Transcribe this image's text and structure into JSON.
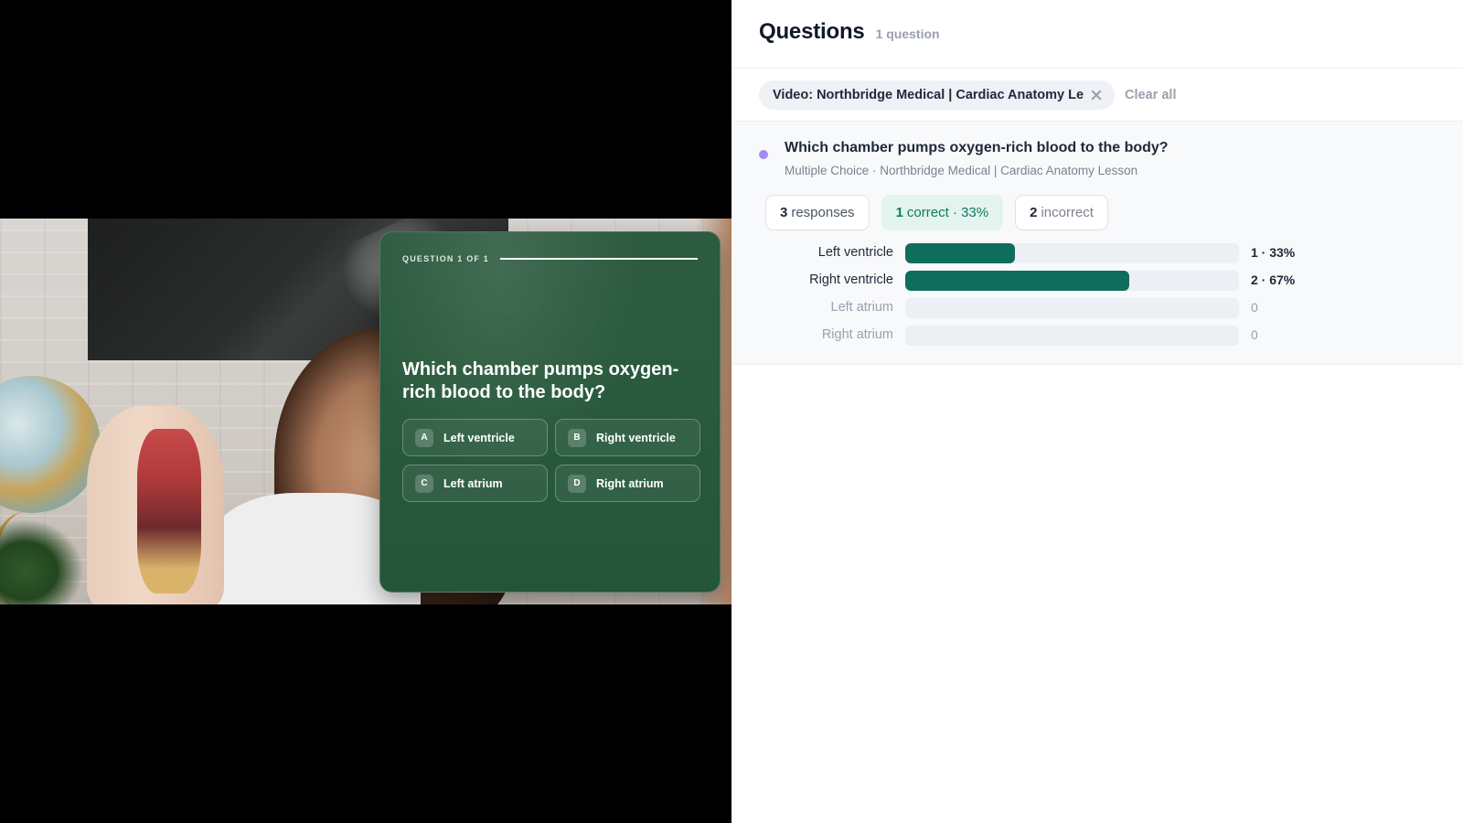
{
  "quiz": {
    "counter": "QUESTION 1 OF 1",
    "progress": 1.0,
    "question": "Which chamber pumps oxygen-rich blood to the body?",
    "options": [
      {
        "letter": "A",
        "label": "Left ventricle"
      },
      {
        "letter": "B",
        "label": "Right ventricle"
      },
      {
        "letter": "C",
        "label": "Left atrium"
      },
      {
        "letter": "D",
        "label": "Right atrium"
      }
    ]
  },
  "panel": {
    "title": "Questions",
    "count": "1 question",
    "filter_chip": "Video: Northbridge Medical | Cardiac Anatomy Le",
    "clear_all": "Clear all"
  },
  "question_item": {
    "text": "Which chamber pumps oxygen-rich blood to the body?",
    "meta": "Multiple Choice · Northbridge Medical | Cardiac Anatomy Lesson",
    "accent_color": "#a58cf0",
    "stats": {
      "responses_num": "3",
      "responses_txt": "responses",
      "correct_num": "1",
      "correct_txt": "correct · 33%",
      "incorrect_num": "2",
      "incorrect_txt": "incorrect"
    },
    "answers": [
      {
        "label": "Left ventricle",
        "count": 1,
        "percent": 33,
        "value_text": "1 · 33%"
      },
      {
        "label": "Right ventricle",
        "count": 2,
        "percent": 67,
        "value_text": "2 · 67%"
      },
      {
        "label": "Left atrium",
        "count": 0,
        "percent": 0,
        "value_text": "0"
      },
      {
        "label": "Right atrium",
        "count": 0,
        "percent": 0,
        "value_text": "0"
      }
    ]
  },
  "colors": {
    "bar_fill": "#0f6e5b",
    "correct_pill_bg": "#e3f3ee",
    "correct_pill_text": "#0f7a5f",
    "quiz_card": "#2a5a3d"
  }
}
